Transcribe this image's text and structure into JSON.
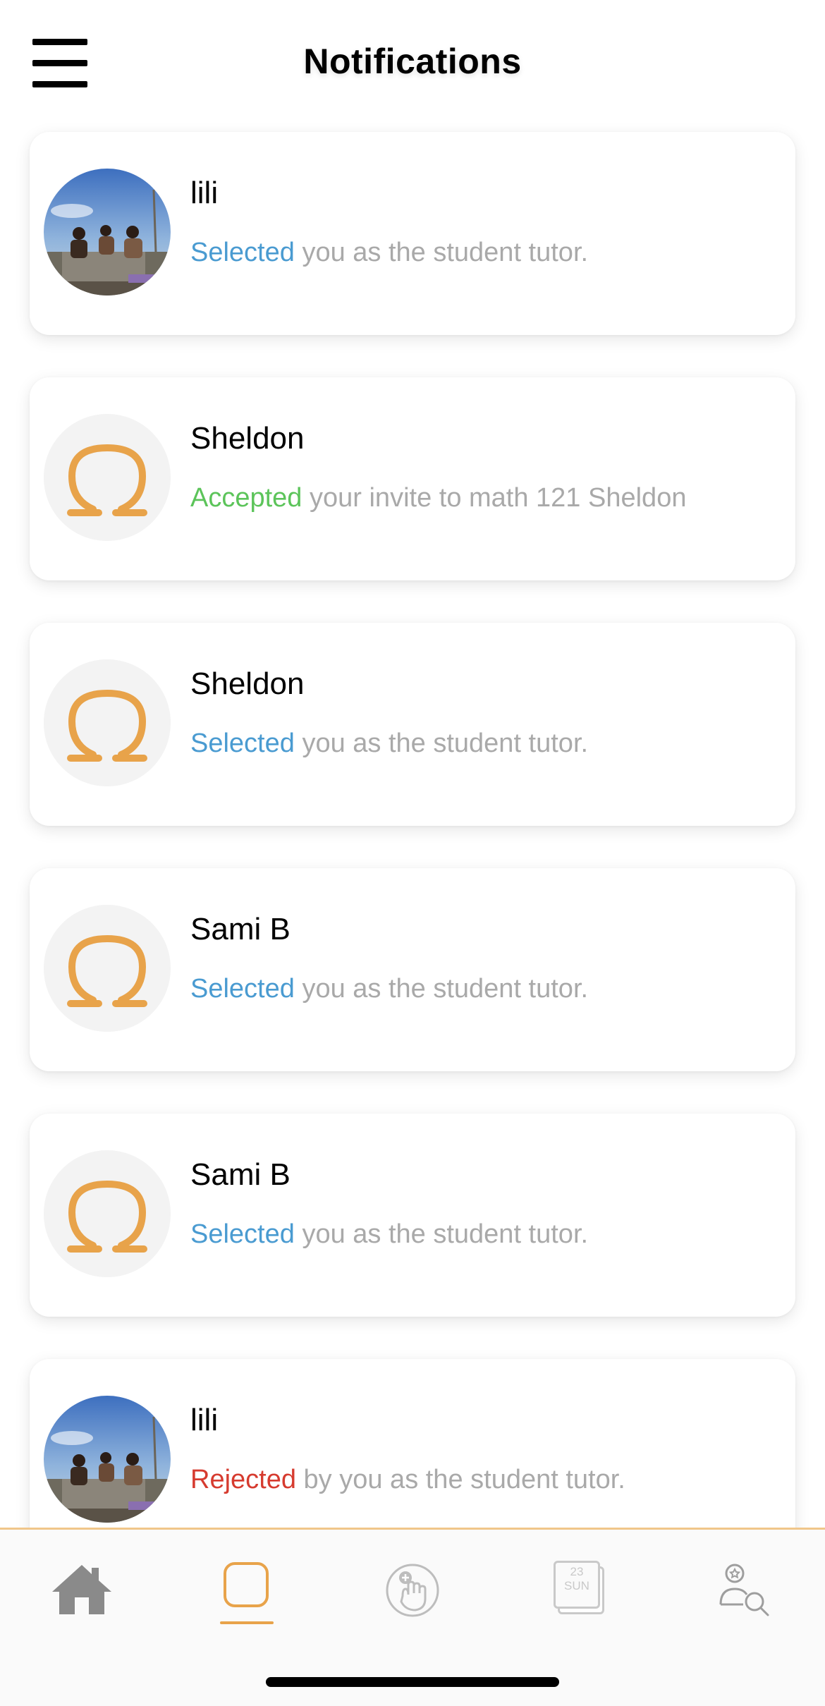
{
  "header": {
    "title": "Notifications",
    "menu_icon": "hamburger-menu-icon"
  },
  "colors": {
    "selected": "#4a9bd1",
    "accepted": "#5cc45a",
    "rejected": "#d63b2f",
    "message": "#a9a9a9",
    "accent": "#e8a34a"
  },
  "notifications": [
    {
      "name": "lili",
      "action": "Selected",
      "rest": " you as the student tutor.",
      "status": "selected",
      "avatar": "photo"
    },
    {
      "name": "Sheldon",
      "action": "Accepted",
      "rest": " your invite to math 121 Sheldon",
      "status": "accepted",
      "avatar": "omega"
    },
    {
      "name": "Sheldon",
      "action": "Selected",
      "rest": " you as the student tutor.",
      "status": "selected",
      "avatar": "omega"
    },
    {
      "name": "Sami B",
      "action": "Selected",
      "rest": " you as the student tutor.",
      "status": "selected",
      "avatar": "omega"
    },
    {
      "name": "Sami B",
      "action": "Selected",
      "rest": " you as the student tutor.",
      "status": "selected",
      "avatar": "omega"
    },
    {
      "name": "lili",
      "action": "Rejected",
      "rest": " by you as the student tutor.",
      "status": "rejected",
      "avatar": "photo"
    }
  ],
  "tabbar": {
    "tabs": [
      {
        "icon": "home-icon",
        "active": false
      },
      {
        "icon": "notifications-square-icon",
        "active": true
      },
      {
        "icon": "raise-hand-icon",
        "active": false
      },
      {
        "icon": "calendar-icon",
        "active": false,
        "calendar_day": "23",
        "calendar_weekday": "SUN"
      },
      {
        "icon": "tutor-search-icon",
        "active": false
      }
    ]
  }
}
